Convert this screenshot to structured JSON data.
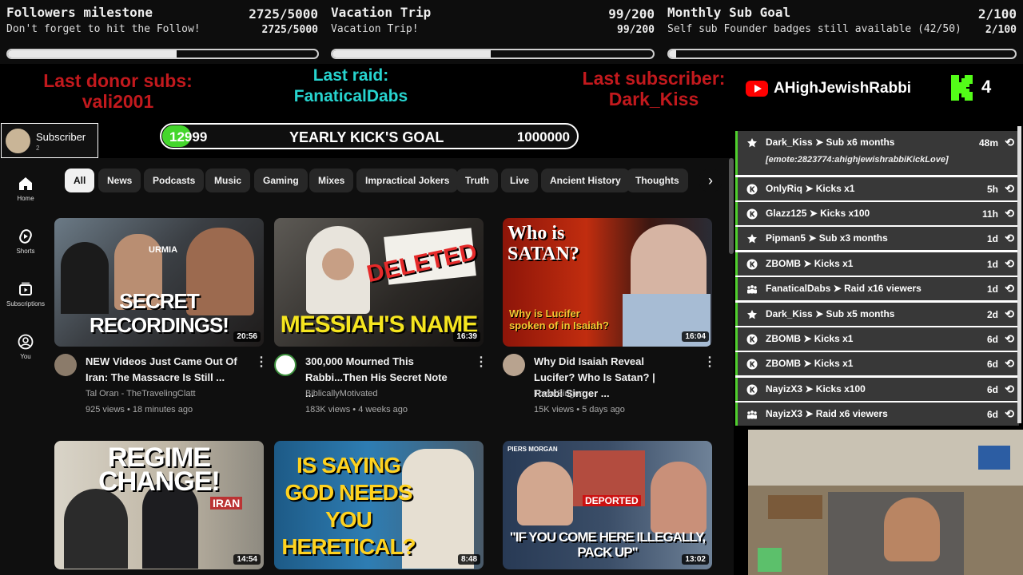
{
  "goals": [
    {
      "title": "Followers milestone",
      "subtitle": "Don't forget to hit the Follow!",
      "count": "2725/5000",
      "progress": 0.545
    },
    {
      "title": "Vacation Trip",
      "subtitle": "Vacation Trip!",
      "count": "99/200",
      "progress": 0.495
    },
    {
      "title": "Monthly Sub Goal",
      "subtitle": "Self sub Founder badges still available (42/50)",
      "count": "2/100",
      "progress": 0.02
    }
  ],
  "labels": {
    "donor_title": "Last donor subs:",
    "donor_name": "vali2001",
    "raid_title": "Last raid:",
    "raid_name": "FanaticalDabs",
    "sub_title": "Last subscriber:",
    "sub_name": "Dark_Kiss"
  },
  "channel": {
    "name": "AHighJewishRabbi",
    "kick_count": "4",
    "youtube_color": "#ff0000",
    "kick_color": "#53fc18"
  },
  "subscriber_box": {
    "label": "Subscriber",
    "count": "2"
  },
  "kick_goal": {
    "current": "12999",
    "title": "YEARLY KICK'S GOAL",
    "target": "1000000",
    "progress": 0.013
  },
  "rail": [
    {
      "label": "Home",
      "icon": "home-icon"
    },
    {
      "label": "Shorts",
      "icon": "shorts-icon"
    },
    {
      "label": "Subscriptions",
      "icon": "subscriptions-icon"
    },
    {
      "label": "You",
      "icon": "you-icon"
    }
  ],
  "chips": [
    "All",
    "News",
    "Podcasts",
    "Music",
    "Gaming",
    "Mixes",
    "Impractical Jokers",
    "Truth",
    "Live",
    "Ancient History",
    "Thoughts"
  ],
  "videos": [
    {
      "thumb_text": "SECRET RECORDINGS!",
      "thumb_tag": "URMIA",
      "duration": "20:56",
      "title": "NEW Videos Just Came Out Of Iran: The Massacre Is Still ...",
      "channel": "Tal Oran - TheTravelingClatt",
      "meta": "925 views • 18 minutes ago"
    },
    {
      "thumb_text": "MESSIAH'S NAME",
      "thumb_tag": "DELETED",
      "duration": "16:39",
      "title": "300,000 Mourned This Rabbi...Then His Secret Note ...",
      "channel": "BiblicallyMotivated",
      "meta": "183K views • 4 weeks ago"
    },
    {
      "thumb_text": "Why is Lucifer spoken of in Isaiah?",
      "thumb_tag": "Who is SATAN?",
      "duration": "16:04",
      "title": "Why Did Isaiah Reveal Lucifer? Who Is Satan? | Rabbi Singer ...",
      "channel": "Tovia Singer",
      "meta": "15K views • 5 days ago"
    },
    {
      "thumb_text": "REGIME CHANGE!",
      "thumb_tag": "IRAN",
      "duration": "14:54"
    },
    {
      "thumb_text": "IS SAYING GOD NEEDS YOU HERETICAL?",
      "thumb_tag": "",
      "duration": "8:48"
    },
    {
      "thumb_text": "\"IF YOU COME HERE ILLEGALLY, PACK UP\"",
      "thumb_tag": "DEPORTED",
      "duration": "13:02",
      "badge": "PIERS MORGAN"
    }
  ],
  "feed": [
    {
      "icon": "star-icon",
      "user": "Dark_Kiss",
      "action": "Sub x6 months",
      "time": "48m",
      "emote": "[emote:2823774:ahighjewishrabbiKickLove]"
    },
    {
      "icon": "kick-icon",
      "user": "OnlyRiq",
      "action": "Kicks x1",
      "time": "5h"
    },
    {
      "icon": "kick-icon",
      "user": "Glazz125",
      "action": "Kicks x100",
      "time": "11h"
    },
    {
      "icon": "star-icon",
      "user": "Pipman5",
      "action": "Sub x3 months",
      "time": "1d"
    },
    {
      "icon": "kick-icon",
      "user": "ZBOMB",
      "action": "Kicks x1",
      "time": "1d"
    },
    {
      "icon": "raid-icon",
      "user": "FanaticalDabs",
      "action": "Raid x16 viewers",
      "time": "1d"
    },
    {
      "icon": "star-icon",
      "user": "Dark_Kiss",
      "action": "Sub x5 months",
      "time": "2d"
    },
    {
      "icon": "kick-icon",
      "user": "ZBOMB",
      "action": "Kicks x1",
      "time": "6d"
    },
    {
      "icon": "kick-icon",
      "user": "ZBOMB",
      "action": "Kicks x1",
      "time": "6d"
    },
    {
      "icon": "kick-icon",
      "user": "NayizX3",
      "action": "Kicks x100",
      "time": "6d"
    },
    {
      "icon": "raid-icon",
      "user": "NayizX3",
      "action": "Raid x6 viewers",
      "time": "6d"
    }
  ],
  "separator": "➤",
  "replay_glyph": "⟲",
  "colors": {
    "kick_green": "#53fc18",
    "accent_red": "#c2191d",
    "accent_cyan": "#27d4cf",
    "feed_row": "#383838"
  }
}
